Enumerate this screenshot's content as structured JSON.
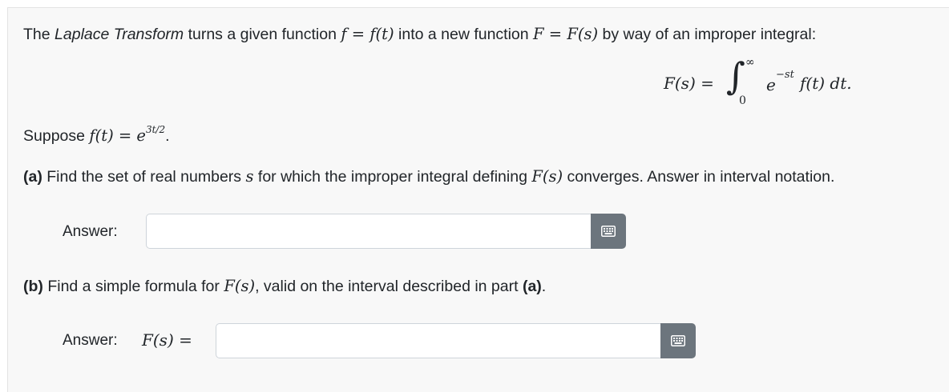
{
  "intro": {
    "p1": "The ",
    "laplace": "Laplace Transform",
    "p2": " turns a given function ",
    "m1": "f = f(t)",
    "p3": " into a new function ",
    "m2": "F = F(s)",
    "p4": " by way of an improper integral:"
  },
  "formula": {
    "lhs": "F(s) =",
    "integral_sign": "∫",
    "upper": "∞",
    "lower": "0",
    "exp_base": "e",
    "exp_power": "−st",
    "integrand": "f(t) dt."
  },
  "suppose": {
    "prefix": "Suppose ",
    "lhs": "f(t) = e",
    "exponent": "3t/2",
    "dot": "."
  },
  "part_a": {
    "tag": "(a)",
    "t1": " Find the set of real numbers ",
    "var": "s",
    "t2": " for which the improper integral defining ",
    "fs": "F(s)",
    "t3": " converges. Answer in interval notation.",
    "answer_label": "Answer:",
    "value": ""
  },
  "part_b": {
    "tag": "(b)",
    "t1": " Find a simple formula for ",
    "fs": "F(s)",
    "t2": ", valid on the interval described in part ",
    "ref": "(a)",
    "t3": ".",
    "answer_label": "Answer:",
    "answer_math": "F(s) =",
    "value": ""
  },
  "icons": {
    "keyboard": "keyboard-icon"
  },
  "colors": {
    "button": "#6c757d",
    "panel": "#f8f8f8"
  }
}
